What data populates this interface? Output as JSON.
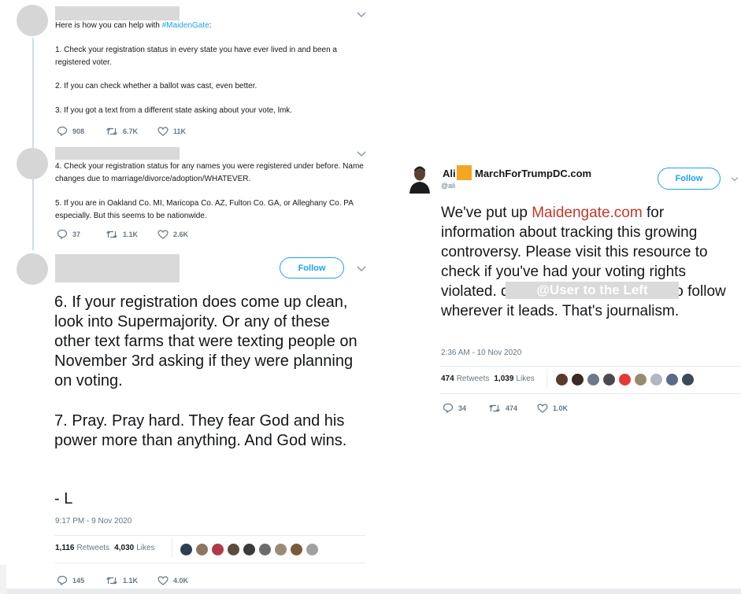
{
  "left": {
    "tweet1": {
      "intro_prefix": "Here is how you can help with ",
      "intro_hashtag": "#MaidenGate",
      "intro_suffix": ":",
      "p1": "1. Check your registration status in every state you have ever lived in and been a registered voter.",
      "p2": "2. If you can check whether a ballot was cast, even better.",
      "p3": "3. If you got a text from a different state asking about your vote, lmk.",
      "replies": "908",
      "retweets": "6.7K",
      "likes": "11K"
    },
    "tweet2": {
      "p1": "4. Check your registration status for any names you were registered under before. Name changes due to marriage/divorce/adoption/WHATEVER.",
      "p2": "5. If you are in Oakland Co. MI, Maricopa Co. AZ, Fulton Co. GA, or Alleghany Co. PA especially. But this seems to be nationwide.",
      "replies": "37",
      "retweets": "1.1K",
      "likes": "2.6K"
    },
    "tweet3": {
      "follow_label": "Follow",
      "p1": "6. If your registration does come up clean, look into Supermajority. Or any of these other text farms that were texting people on November 3rd asking if they were planning on voting.",
      "p2": "7. Pray. Pray hard. They fear God and his power more than anything. And God wins.",
      "p3": "- L",
      "timestamp": "9:17 PM - 9 Nov 2020",
      "retweets_count": "1,116",
      "retweets_label": "Retweets",
      "likes_count": "4,030",
      "likes_label": "Likes",
      "replies": "145",
      "retweets": "1.1K",
      "likes": "4.0K"
    }
  },
  "right": {
    "name": "Ali",
    "handle_site": "MarchForTrumpDC.com",
    "username": "@ali",
    "follow_label": "Follow",
    "text_a": "We've put up ",
    "text_link": "Maidengate.com",
    "text_b": " for information about tracking this growing controversy. Please visit this resource to check if you've had your voting rights violated.",
    "overlay_label": "@User to the Left",
    "text_c": " did good and she's going to follow wherever it leads. That's journalism.",
    "timestamp": "2:36 AM - 10 Nov 2020",
    "retweets_count": "474",
    "retweets_label": "Retweets",
    "likes_count": "1,039",
    "likes_label": "Likes",
    "replies": "34",
    "retweets": "474",
    "likes": "1.0K"
  },
  "colors": {
    "link": "#1da1f2",
    "site_link": "#c0392b",
    "square": "#f5a623"
  }
}
